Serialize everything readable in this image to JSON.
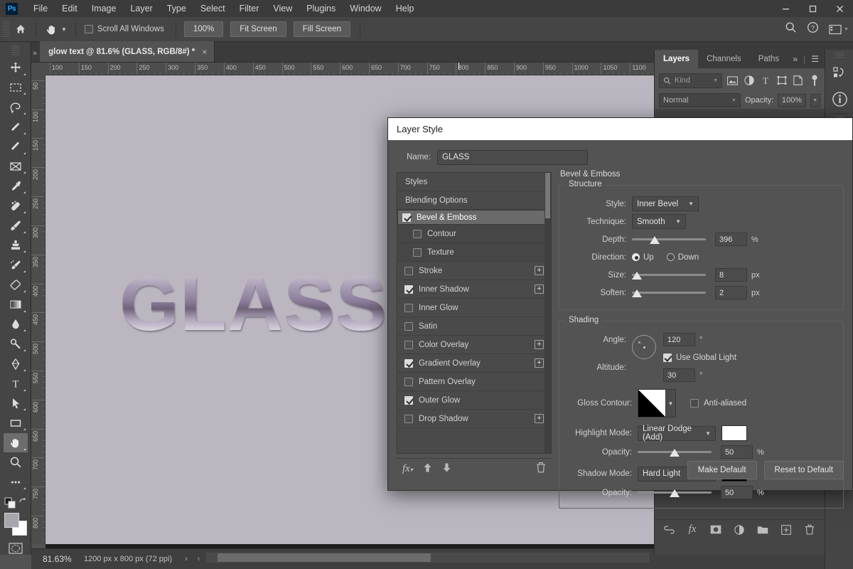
{
  "titlebar": {
    "app_logo": "Ps",
    "menus": [
      "File",
      "Edit",
      "Image",
      "Layer",
      "Type",
      "Select",
      "Filter",
      "View",
      "Plugins",
      "Window",
      "Help"
    ],
    "window_controls": [
      "minimize",
      "maximize",
      "close"
    ]
  },
  "options_bar": {
    "home_icon": "home-icon",
    "tool_icon": "hand-tool-icon",
    "scroll_all_windows": {
      "label": "Scroll All Windows",
      "checked": false
    },
    "buttons": [
      "100%",
      "Fit Screen",
      "Fill Screen"
    ],
    "right_icons": [
      "search-icon",
      "help-icon",
      "workspace-icon"
    ]
  },
  "toolbar": {
    "tools": [
      {
        "name": "move-tool",
        "glyph": "move"
      },
      {
        "name": "marquee-tool",
        "glyph": "marquee"
      },
      {
        "name": "lasso-tool",
        "glyph": "lasso"
      },
      {
        "name": "quick-selection-tool",
        "glyph": "wand"
      },
      {
        "name": "crop-tool",
        "glyph": "crop"
      },
      {
        "name": "frame-tool",
        "glyph": "frame"
      },
      {
        "name": "eyedropper-tool",
        "glyph": "eyedropper"
      },
      {
        "name": "spot-healing-tool",
        "glyph": "healing"
      },
      {
        "name": "brush-tool",
        "glyph": "brush"
      },
      {
        "name": "clone-stamp-tool",
        "glyph": "stamp"
      },
      {
        "name": "history-brush-tool",
        "glyph": "history"
      },
      {
        "name": "eraser-tool",
        "glyph": "eraser"
      },
      {
        "name": "gradient-tool",
        "glyph": "gradient"
      },
      {
        "name": "blur-tool",
        "glyph": "blur"
      },
      {
        "name": "dodge-tool",
        "glyph": "dodge"
      },
      {
        "name": "pen-tool",
        "glyph": "pen"
      },
      {
        "name": "path-selection-tool",
        "glyph": "path"
      },
      {
        "name": "type-tool",
        "glyph": "T"
      },
      {
        "name": "rectangle-tool",
        "glyph": "rect"
      },
      {
        "name": "hand-tool",
        "glyph": "hand",
        "active": true
      },
      {
        "name": "zoom-tool",
        "glyph": "zoom"
      },
      {
        "name": "edit-toolbar",
        "glyph": "dots"
      }
    ],
    "foreground_color": "#a9a5ae",
    "background_color": "#ffffff"
  },
  "document_tab": {
    "title": "glow text @ 81.6% (GLASS, RGB/8#) *",
    "close_label": "×"
  },
  "rulers": {
    "horizontal_labels": [
      "100",
      "150",
      "200",
      "250",
      "300",
      "350",
      "400",
      "450",
      "500",
      "550",
      "600",
      "650",
      "700",
      "750",
      "800",
      "850",
      "900",
      "950",
      "1000",
      "1050",
      "1100"
    ],
    "vertical_labels": [
      "50",
      "100",
      "150",
      "200",
      "250",
      "300",
      "350",
      "400",
      "450",
      "500",
      "550",
      "600",
      "650",
      "700",
      "750",
      "800"
    ]
  },
  "canvas": {
    "artwork_text": "GLASS",
    "background_color": "#bbb6c0"
  },
  "status_bar": {
    "zoom": "81.63%",
    "doc_info": "1200 px x 800 px (72 ppi)",
    "arrow_right": "›",
    "arrow_left": "‹"
  },
  "layers_panel": {
    "tabs": [
      "Layers",
      "Channels",
      "Paths"
    ],
    "active_tab": "Layers",
    "overflow_icon": "chevron-double-right-icon",
    "menu_icon": "panel-menu-icon",
    "filter": {
      "placeholder": "Kind",
      "search_icon": "search-icon"
    },
    "filter_icons": [
      "image-filter-icon",
      "adjustment-filter-icon",
      "type-filter-icon",
      "shape-filter-icon",
      "smartobject-filter-icon",
      "filter-toggle-icon"
    ],
    "blend_mode": "Normal",
    "opacity_label": "Opacity:",
    "opacity_value": "100%",
    "bottom_icons": [
      "link-layers-icon",
      "fx-icon",
      "layer-mask-icon",
      "adjustment-layer-icon",
      "new-group-icon",
      "new-layer-icon",
      "delete-layer-icon"
    ]
  },
  "rail": {
    "icons": [
      "libraries-icon",
      "info-icon",
      "properties-icon"
    ]
  },
  "dialog": {
    "title": "Layer Style",
    "name_label": "Name:",
    "name_value": "GLASS",
    "styles_list": [
      {
        "label": "Styles",
        "type": "header",
        "checkbox": false,
        "checked": false,
        "plus": false,
        "selected": false
      },
      {
        "label": "Blending Options",
        "type": "header",
        "checkbox": false,
        "checked": false,
        "plus": false,
        "selected": false
      },
      {
        "label": "Bevel & Emboss",
        "type": "item",
        "checkbox": true,
        "checked": true,
        "plus": false,
        "selected": true
      },
      {
        "label": "Contour",
        "type": "sub",
        "checkbox": true,
        "checked": false,
        "plus": false,
        "selected": false
      },
      {
        "label": "Texture",
        "type": "sub",
        "checkbox": true,
        "checked": false,
        "plus": false,
        "selected": false
      },
      {
        "label": "Stroke",
        "type": "item",
        "checkbox": true,
        "checked": false,
        "plus": true,
        "selected": false
      },
      {
        "label": "Inner Shadow",
        "type": "item",
        "checkbox": true,
        "checked": true,
        "plus": true,
        "selected": false
      },
      {
        "label": "Inner Glow",
        "type": "item",
        "checkbox": true,
        "checked": false,
        "plus": false,
        "selected": false
      },
      {
        "label": "Satin",
        "type": "item",
        "checkbox": true,
        "checked": false,
        "plus": false,
        "selected": false
      },
      {
        "label": "Color Overlay",
        "type": "item",
        "checkbox": true,
        "checked": false,
        "plus": true,
        "selected": false
      },
      {
        "label": "Gradient Overlay",
        "type": "item",
        "checkbox": true,
        "checked": true,
        "plus": true,
        "selected": false
      },
      {
        "label": "Pattern Overlay",
        "type": "item",
        "checkbox": true,
        "checked": false,
        "plus": false,
        "selected": false
      },
      {
        "label": "Outer Glow",
        "type": "item",
        "checkbox": true,
        "checked": true,
        "plus": false,
        "selected": false
      },
      {
        "label": "Drop Shadow",
        "type": "item",
        "checkbox": true,
        "checked": false,
        "plus": true,
        "selected": false
      }
    ],
    "styles_footer_icons": [
      "fx-icon",
      "move-up-icon",
      "move-down-icon",
      "delete-effect-icon"
    ],
    "panel_title": "Bevel & Emboss",
    "structure": {
      "title": "Structure",
      "style": {
        "label": "Style:",
        "value": "Inner Bevel"
      },
      "technique": {
        "label": "Technique:",
        "value": "Smooth"
      },
      "depth": {
        "label": "Depth:",
        "value": "396",
        "unit": "%",
        "slider_pct": 31
      },
      "direction": {
        "label": "Direction:",
        "up_label": "Up",
        "down_label": "Down",
        "selected": "Up"
      },
      "size": {
        "label": "Size:",
        "value": "8",
        "unit": "px",
        "slider_pct": 5
      },
      "soften": {
        "label": "Soften:",
        "value": "2",
        "unit": "px",
        "slider_pct": 7
      }
    },
    "shading": {
      "title": "Shading",
      "angle": {
        "label": "Angle:",
        "value": "120",
        "unit": "°"
      },
      "use_global_light": {
        "label": "Use Global Light",
        "checked": true
      },
      "altitude": {
        "label": "Altitude:",
        "value": "30",
        "unit": "°"
      },
      "gloss_contour": {
        "label": "Gloss Contour:"
      },
      "anti_aliased": {
        "label": "Anti-aliased",
        "checked": false
      },
      "highlight_mode": {
        "label": "Highlight Mode:",
        "value": "Linear Dodge (Add)",
        "color": "#ffffff"
      },
      "highlight_opacity": {
        "label": "Opacity:",
        "value": "50",
        "unit": "%",
        "slider_pct": 50
      },
      "shadow_mode": {
        "label": "Shadow Mode:",
        "value": "Hard Light",
        "color": "#000000"
      },
      "shadow_opacity": {
        "label": "Opacity:",
        "value": "50",
        "unit": "%",
        "slider_pct": 50
      }
    },
    "footer_buttons": [
      "Make Default",
      "Reset to Default"
    ]
  }
}
